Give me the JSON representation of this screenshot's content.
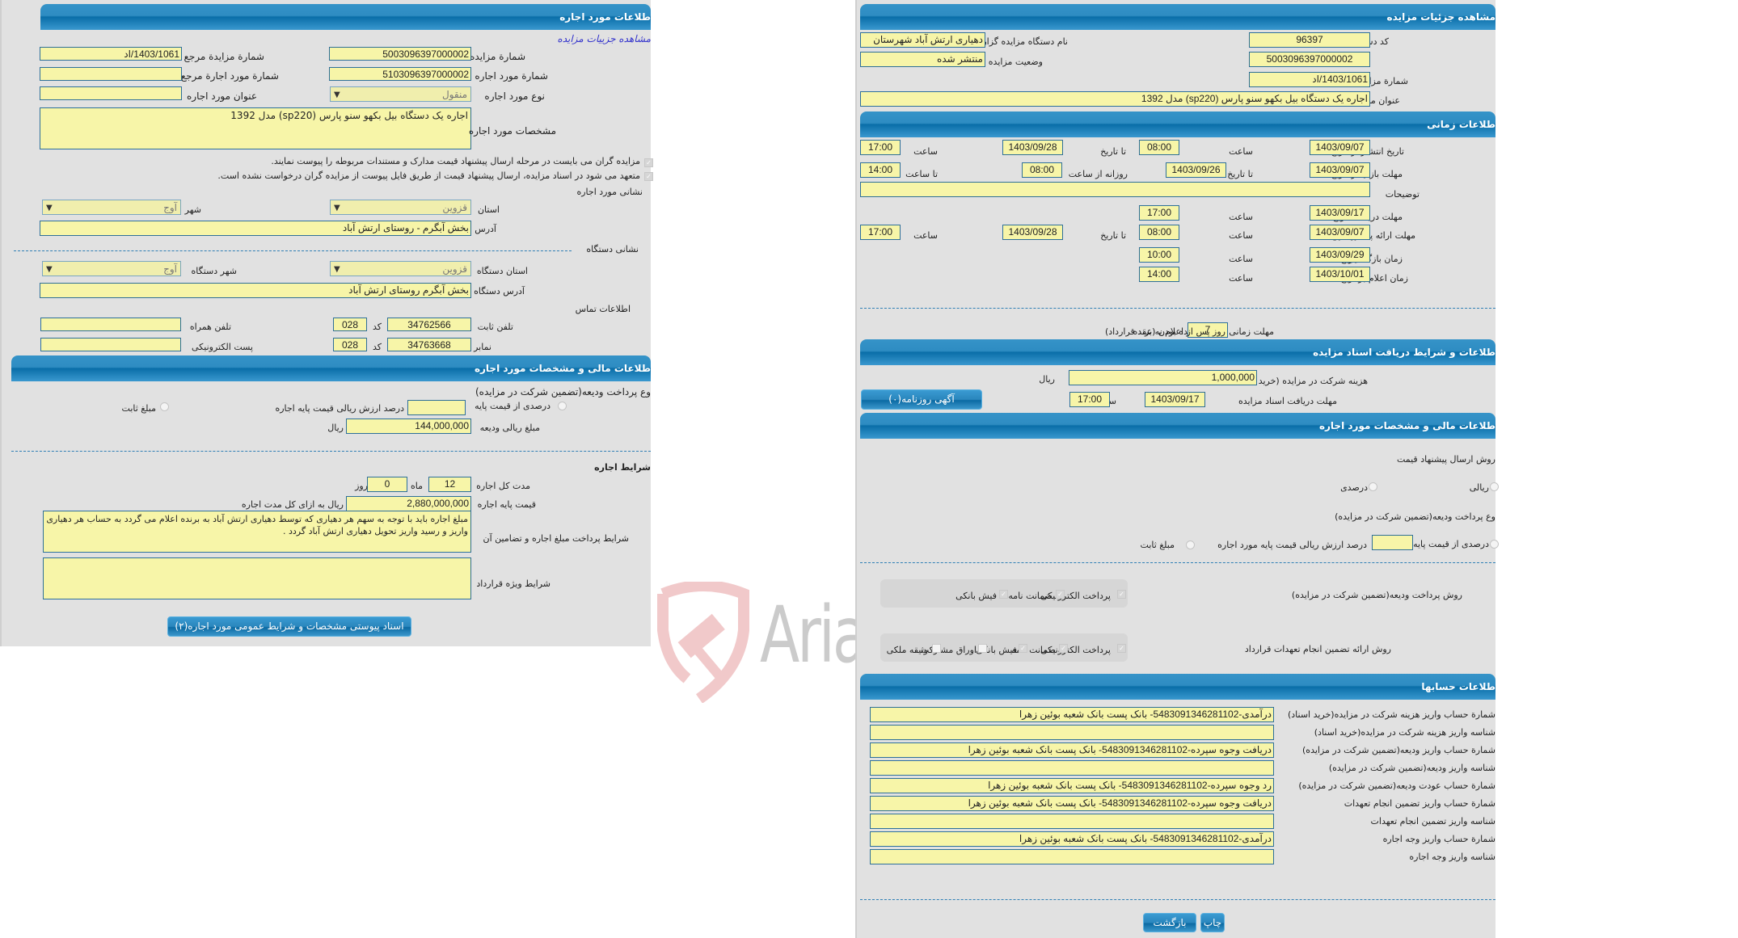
{
  "left": {
    "header": "طلاعات مورد اجاره",
    "view_details_link": "مشاهده جزییات مزایده",
    "fields": {
      "auction_no_label": "شمارة مزایده",
      "auction_no": "5003096397000002",
      "ref_auction_no_label": "شمارة مزایدة مرجع",
      "ref_auction_no": "1403/1061/اد",
      "lease_item_no_label": "شمارة مورد اجاره",
      "lease_item_no": "5103096397000002",
      "ref_lease_item_no_label": "شمارة مورد اجارة مرجع",
      "ref_lease_item_no": "",
      "lease_type_label": "نوع مورد اجاره",
      "lease_type": "منقول",
      "lease_title_label": "عنوان مورد اجاره",
      "lease_title": "",
      "specs_label": "مشخصات مورد اجاره",
      "specs": "اجاره یک دستگاه بیل بکهو سنو پارس (sp220) مدل 1392"
    },
    "notes": [
      "مزایده گران می بایست در مرحله ارسال پیشنهاد قیمت مدارک و مستندات مربوطه را پیوست نمایند.",
      "متعهد می شود در اسناد مزایده، ارسال پیشنهاد قیمت از طریق فایل پیوست از مزایده گران درخواست نشده است."
    ],
    "lease_address": {
      "title": "نشانی مورد اجاره",
      "province_label": "استان",
      "province": "قزوین",
      "city_label": "شهر",
      "city": "آوج",
      "address_label": "آدرس",
      "address": "بخش آبگرم - روستای ارتش آباد"
    },
    "device_address": {
      "title": "نشانی دستگاه",
      "province_label": "استان دستگاه",
      "province": "قزوین",
      "city_label": "شهر دستگاه",
      "city": "آوج",
      "address_label": "آدرس دستگاه",
      "address": "بخش آبگرم  روستای ارتش آباد"
    },
    "contact": {
      "title": "اطلاعات تماس",
      "phone_label": "تلفن ثابت",
      "phone": "34762566",
      "phone_code_label": "کد",
      "phone_code": "028",
      "mobile_label": "تلفن همراه",
      "mobile": "",
      "fax_label": "نمابر",
      "fax": "34763668",
      "fax_code_label": "کد",
      "fax_code": "028",
      "email_label": "پست الکترونیکی",
      "email": ""
    },
    "financial": {
      "header": "طلاعات مالی و مشخصات مورد اجاره",
      "deposit_type_label": "وع پرداخت ودیعه(تضمین شرکت در مزایده)",
      "percent_option": "درصدی از قیمت پایه",
      "percent_suffix": "درصد ارزش ریالی قیمت پایه اجاره",
      "percent_value": "",
      "fixed_option": "مبلغ ثابت",
      "deposit_amount_label": "مبلغ ریالی ودیعه",
      "deposit_amount": "144,000,000",
      "deposit_unit": "ریال"
    },
    "terms": {
      "title": "شرایط اجاره",
      "duration_label": "مدت کل اجاره",
      "months": "12",
      "months_label": "ماه",
      "days": "0",
      "days_label": "روز",
      "base_price_label": "قیمت پایه اجاره",
      "base_price": "2,880,000,000",
      "base_price_suffix": "ریال به ازای کل مدت اجاره",
      "payment_terms_label": "شرایط پرداخت مبلغ اجاره و تضامین آن",
      "payment_terms": "مبلغ اجاره باید با توجه به سهم هر دهیاری که توسط دهیاری ارتش آباد به برنده اعلام می گردد به حساب هر دهیاری واریز و رسید واریز تحویل دهیاری ارتش آباد گردد .",
      "special_terms_label": "شرایط ویژه قرارداد",
      "special_terms": ""
    },
    "attachments_button": "اسناد پیوستی مشخصات و شرایط عمومی مورد اجاره(۲)"
  },
  "right": {
    "header": "مشاهده جزئیات مزایده",
    "org_code_label": "کد دستگاه مزایده گزار",
    "org_code": "96397",
    "org_name_label": "نام دستگاه مزایده گزار",
    "org_name": "دهیاری ارتش آباد شهرستان",
    "auction_no_label": "شمارة مزایده",
    "auction_no": "5003096397000002",
    "status_label": "وضعیت مزایده",
    "status": "منتشر شده",
    "ref_no_label": "شمارة مزایدة مرجع",
    "ref_no": "1403/1061/اد",
    "title_label": "عنوان مزایده",
    "title": "اجاره یک دستگاه بیل بکهو سنو پارس (sp220) مدل 1392",
    "timing": {
      "header": "طلاعات زمانی",
      "publish_label": "تاریخ انتشار",
      "from_date_label": "از تاریخ",
      "to_date_label": "تا تاریخ",
      "time_label": "ساعت",
      "until_time_label": "تا ساعت",
      "daily_from_label": "روزانه از ساعت",
      "date_label": "تاریخ",
      "publish_from": "1403/09/07",
      "publish_from_time": "08:00",
      "publish_to": "1403/09/28",
      "publish_to_time": "17:00",
      "visit_label": "مهلت بازدید",
      "visit_from": "1403/09/07",
      "visit_to": "1403/09/26",
      "visit_daily_from": "08:00",
      "visit_until": "14:00",
      "description_label": "توضیحات",
      "description": "",
      "doc_deadline_label": "مهلت دریافت اسناد",
      "doc_to": "1403/09/17",
      "doc_time": "17:00",
      "offer_label": "مهلت ارائه پیشنهاد",
      "offer_from": "1403/09/07",
      "offer_from_time": "08:00",
      "offer_to": "1403/09/28",
      "offer_to_time": "17:00",
      "opening_label": "زمان بازگشایی",
      "opening_date": "1403/09/29",
      "opening_time": "10:00",
      "winner_label": "زمان اعلام برنده",
      "winner_date": "1403/10/01",
      "winner_time": "14:00",
      "acceptance_label": "مهلت زمانی پذیرش برنده بودن (عقد قرارداد)",
      "acceptance_days": "7",
      "acceptance_suffix": "روز پس از اعلام به برنده"
    },
    "docs": {
      "header": "طلاعات و شرایط دریافت اسناد مزایده",
      "fee_label": "هزینه شرکت در مزایده (خرید اسناد)",
      "fee": "1,000,000",
      "fee_unit": "ریال",
      "deadline_label": "مهلت دریافت اسناد مزایده",
      "to_date_label": "تا تاریخ",
      "deadline_date": "1403/09/17",
      "time_label": "ساعت",
      "deadline_time": "17:00",
      "newspaper_button": "آگهی روزنامه(۰)"
    },
    "financial": {
      "header": "طلاعات مالی و مشخصات مورد اجاره",
      "offer_method_label": "روش ارسال پیشنهاد قیمت",
      "rial_option": "ریالی",
      "percent_option": "درصدی",
      "deposit_type_label": "وع پرداخت ودیعه(تضمین شرکت در مزایده)",
      "percent_base_option": "درصدی از قیمت پایه",
      "percent_suffix": "درصد ارزش ریالی قیمت پایه مورد اجاره",
      "percent_value": "",
      "fixed_option": "مبلغ ثابت",
      "deposit_method_label": "روش پرداخت ودیعه(تضمین شرکت در مزایده)",
      "deposit_methods": [
        {
          "label": "پرداخت الکترونیکی",
          "checked": true
        },
        {
          "label": "ضمانت نامه",
          "checked": true
        },
        {
          "label": "فیش بانکی",
          "checked": true
        }
      ],
      "guarantee_method_label": "روش ارائه تضمین انجام تعهدات قرارداد",
      "guarantee_methods": [
        {
          "label": "پرداخت الکترونیکی",
          "checked": true
        },
        {
          "label": "ضمانت نامه",
          "checked": true
        },
        {
          "label": "فیش بانکی",
          "checked": true
        },
        {
          "label": "اوراق مشارکت",
          "checked": false
        },
        {
          "label": "وثیقه ملکی",
          "checked": false
        }
      ]
    },
    "accounts": {
      "header": "طلاعات حسابها",
      "rows": [
        {
          "label": "شمارة حساب واریز هزینه شرکت در مزایده(خرید اسناد)",
          "value": "درآمدی-5483091346281102- بانک پست بانک شعبه بوئین زهرا"
        },
        {
          "label": "شناسه واریز هزینه شرکت در مزایده(خرید اسناد)",
          "value": ""
        },
        {
          "label": "شمارة حساب واریز ودیعه(تضمین شرکت در مزایده)",
          "value": "دریافت وجوه سپرده-5483091346281102- بانک پست بانک شعبه بوئین زهرا"
        },
        {
          "label": "شناسه واریز ودیعه(تضمین شرکت در مزایده)",
          "value": ""
        },
        {
          "label": "شمارة حساب عودت ودیعه(تضمین شرکت در مزایده)",
          "value": "رد وجوه سپرده-5483091346281102- بانک پست بانک شعبه بوئین زهرا"
        },
        {
          "label": "شمارة حساب واریز تضمین انجام تعهدات",
          "value": "دریافت وجوه سپرده-5483091346281102- بانک پست بانک شعبه بوئین زهرا"
        },
        {
          "label": "شناسه واریز تضمین انجام تعهدات",
          "value": ""
        },
        {
          "label": "شمارة حساب واریز وجه اجاره",
          "value": "درآمدی-5483091346281102- بانک پست بانک شعبه بوئین زهرا"
        },
        {
          "label": "شناسه واریز وجه اجاره",
          "value": ""
        }
      ]
    },
    "print_button": "چاپ",
    "back_button": "بازگشت"
  },
  "watermark": {
    "text": "AriaTender.neT",
    "logo_color": "#e8a6a8"
  },
  "colors": {
    "header_blue": "#2e8cc2",
    "field_yellow": "#f7f5a8",
    "field_border": "#2d6f99",
    "panel_bg": "#e1e1e1"
  }
}
